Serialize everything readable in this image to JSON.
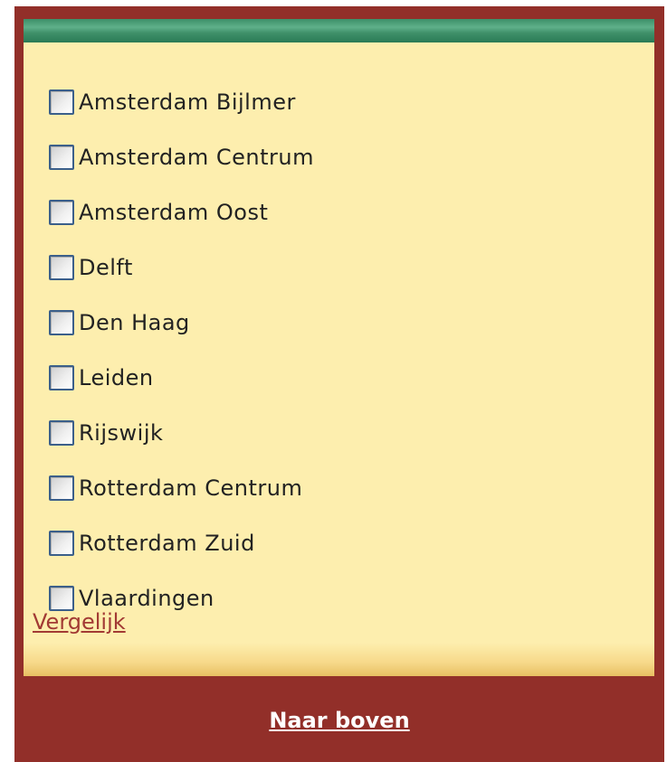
{
  "locations": {
    "items": [
      {
        "label": "Amsterdam Bijlmer"
      },
      {
        "label": "Amsterdam Centrum"
      },
      {
        "label": "Amsterdam Oost"
      },
      {
        "label": "Delft"
      },
      {
        "label": "Den Haag"
      },
      {
        "label": "Leiden"
      },
      {
        "label": "Rijswijk"
      },
      {
        "label": "Rotterdam Centrum"
      },
      {
        "label": "Rotterdam Zuid"
      },
      {
        "label": "Vlaardingen"
      }
    ],
    "compare_label": "Vergelijk"
  },
  "footer": {
    "to_top_label": "Naar boven"
  },
  "colors": {
    "frame": "#922f29",
    "panel": "#fdeeae",
    "header_bar": "#3c8f68",
    "link": "#a23a34",
    "checkbox_border": "#3b5f8a"
  }
}
